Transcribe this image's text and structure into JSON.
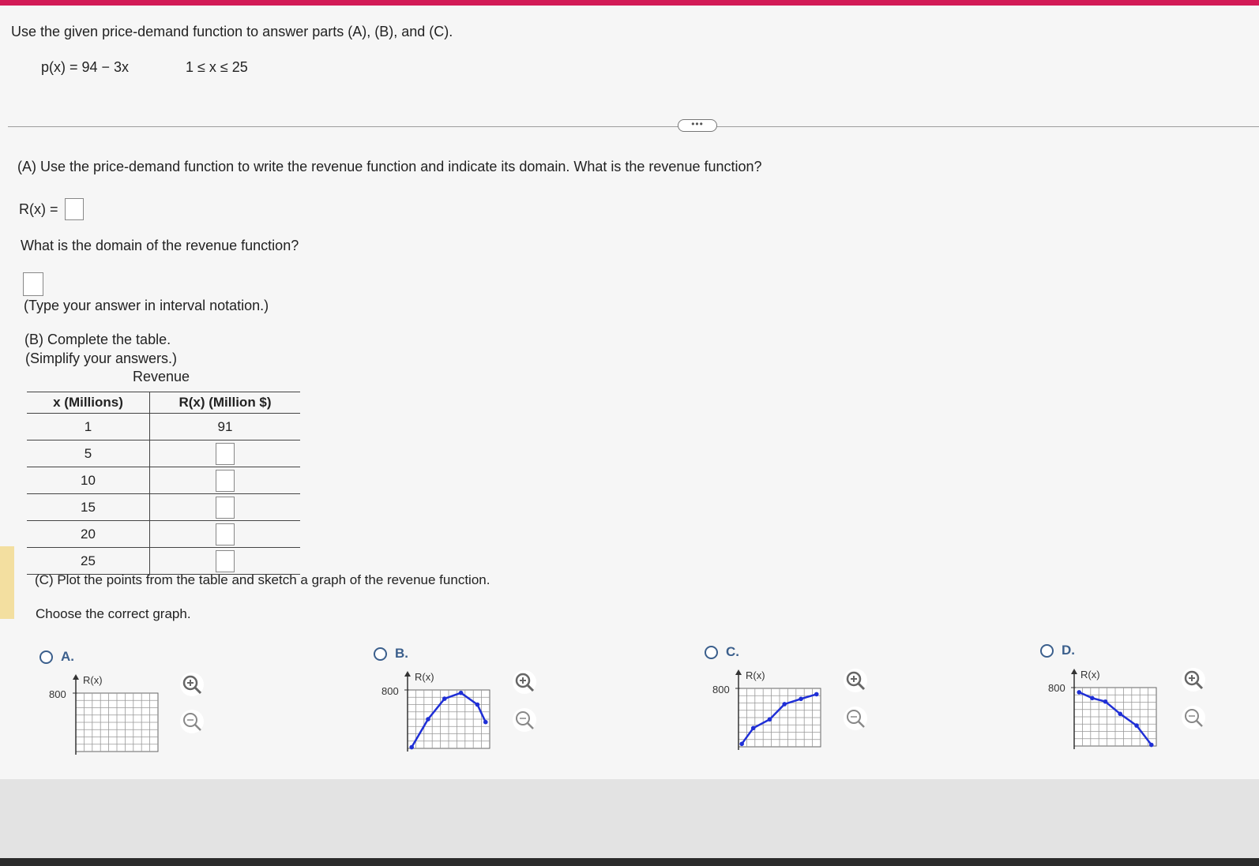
{
  "header": {
    "instruction": "Use the given price-demand function to answer parts (A), (B), and (C).",
    "function": "p(x) = 94 − 3x",
    "constraint": "1 ≤ x ≤ 25",
    "expand_label": "•••"
  },
  "part_a": {
    "question": "(A) Use the price-demand function to write the revenue function and indicate its domain. What is the revenue function?",
    "revenue_label": "R(x) =",
    "domain_question": "What is the domain of the revenue function?",
    "domain_hint": "(Type your answer in interval notation.)"
  },
  "part_b": {
    "instruction": "(B) Complete the table.",
    "simplify": "(Simplify your answers.)",
    "table_title": "Revenue",
    "columns": [
      "x (Millions)",
      "R(x) (Million $)"
    ],
    "rows": [
      {
        "x": "1",
        "r": "91"
      },
      {
        "x": "5",
        "r": ""
      },
      {
        "x": "10",
        "r": ""
      },
      {
        "x": "15",
        "r": ""
      },
      {
        "x": "20",
        "r": ""
      },
      {
        "x": "25",
        "r": ""
      }
    ]
  },
  "part_c": {
    "instruction": "(C) Plot the points from the table and sketch a graph of the revenue function.",
    "choose": "Choose the correct graph.",
    "options": [
      {
        "label": "A.",
        "y_axis": "R(x)",
        "y_tick": "800",
        "shape": "none"
      },
      {
        "label": "B.",
        "y_axis": "R(x)",
        "y_tick": "800",
        "shape": "peak"
      },
      {
        "label": "C.",
        "y_axis": "R(x)",
        "y_tick": "800",
        "shape": "rising"
      },
      {
        "label": "D.",
        "y_axis": "R(x)",
        "y_tick": "800",
        "shape": "falling"
      }
    ]
  },
  "colors": {
    "accent_bar": "#d21a56",
    "option_blue": "#3b5f8c",
    "plot_line": "#1f2fd6"
  },
  "icons": {
    "zoom_in": "zoom-in-icon",
    "zoom_out": "zoom-out-icon"
  }
}
